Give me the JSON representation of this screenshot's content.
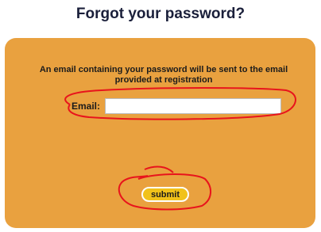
{
  "header": {
    "title": "Forgot your password?"
  },
  "form": {
    "message": "An email containing your password will be sent to the email provided at registration",
    "email_label": "Email:",
    "email_value": "",
    "email_placeholder": "",
    "submit_label": "submit"
  },
  "colors": {
    "panel": "#e9a13f",
    "button": "#f1c21a",
    "annotation": "#e8141c",
    "title": "#1a1f3a"
  }
}
